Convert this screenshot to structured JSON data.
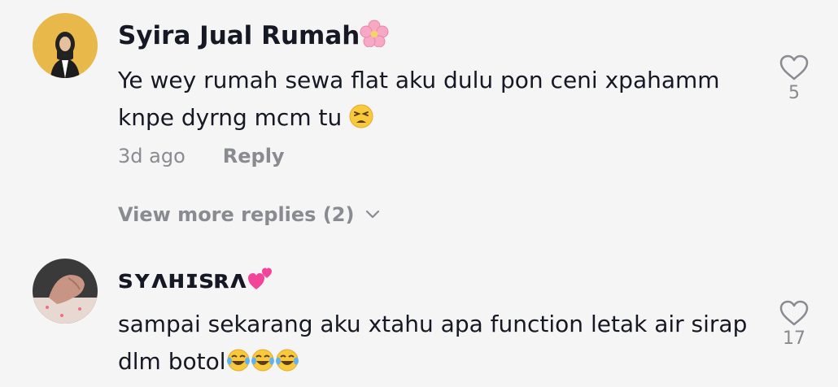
{
  "comments": [
    {
      "username": "Syira Jual Rumah",
      "username_emoji": "cherry-blossom",
      "text_lines": [
        "Ye wey rumah sewa flat aku dulu pon ceni xpahamm",
        "knpe dyrng mcm tu "
      ],
      "text_emoji": "tired-face",
      "time": "3d ago",
      "reply_label": "Reply",
      "likes": "5",
      "more_replies_label": "View more replies (2)"
    },
    {
      "username": "ꜱʏᴧʜɪꜱʀᴧ",
      "username_emoji": "two-hearts",
      "text_lines": [
        "sampai sekarang aku xtahu apa function letak air sirap",
        "dlm botol"
      ],
      "text_emoji": "laughing-tears x3",
      "likes": "17"
    }
  ],
  "colors": {
    "background": "#f5f5f5",
    "primary_text": "#161823",
    "secondary_text": "#8a8b91",
    "avatar1_bg": "#e8b84a"
  }
}
